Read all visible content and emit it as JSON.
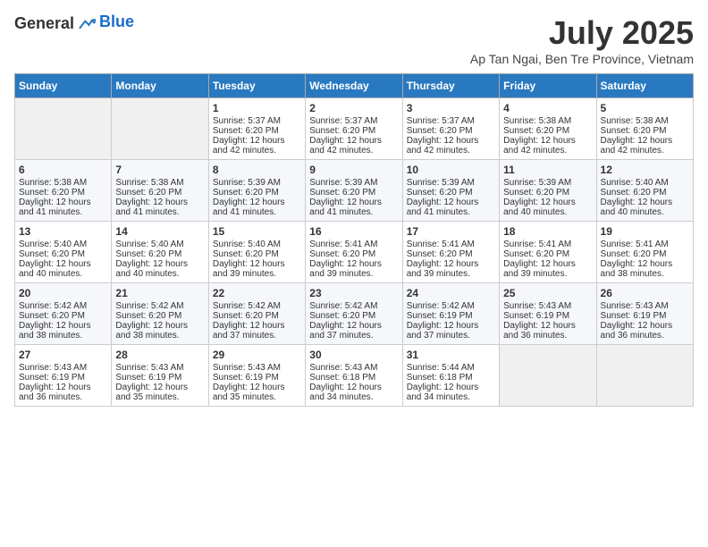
{
  "header": {
    "logo_general": "General",
    "logo_blue": "Blue",
    "month_year": "July 2025",
    "location": "Ap Tan Ngai, Ben Tre Province, Vietnam"
  },
  "days_of_week": [
    "Sunday",
    "Monday",
    "Tuesday",
    "Wednesday",
    "Thursday",
    "Friday",
    "Saturday"
  ],
  "weeks": [
    [
      {
        "day": "",
        "empty": true
      },
      {
        "day": "",
        "empty": true
      },
      {
        "day": "1",
        "sunrise": "Sunrise: 5:37 AM",
        "sunset": "Sunset: 6:20 PM",
        "daylight": "Daylight: 12 hours and 42 minutes."
      },
      {
        "day": "2",
        "sunrise": "Sunrise: 5:37 AM",
        "sunset": "Sunset: 6:20 PM",
        "daylight": "Daylight: 12 hours and 42 minutes."
      },
      {
        "day": "3",
        "sunrise": "Sunrise: 5:37 AM",
        "sunset": "Sunset: 6:20 PM",
        "daylight": "Daylight: 12 hours and 42 minutes."
      },
      {
        "day": "4",
        "sunrise": "Sunrise: 5:38 AM",
        "sunset": "Sunset: 6:20 PM",
        "daylight": "Daylight: 12 hours and 42 minutes."
      },
      {
        "day": "5",
        "sunrise": "Sunrise: 5:38 AM",
        "sunset": "Sunset: 6:20 PM",
        "daylight": "Daylight: 12 hours and 42 minutes."
      }
    ],
    [
      {
        "day": "6",
        "sunrise": "Sunrise: 5:38 AM",
        "sunset": "Sunset: 6:20 PM",
        "daylight": "Daylight: 12 hours and 41 minutes."
      },
      {
        "day": "7",
        "sunrise": "Sunrise: 5:38 AM",
        "sunset": "Sunset: 6:20 PM",
        "daylight": "Daylight: 12 hours and 41 minutes."
      },
      {
        "day": "8",
        "sunrise": "Sunrise: 5:39 AM",
        "sunset": "Sunset: 6:20 PM",
        "daylight": "Daylight: 12 hours and 41 minutes."
      },
      {
        "day": "9",
        "sunrise": "Sunrise: 5:39 AM",
        "sunset": "Sunset: 6:20 PM",
        "daylight": "Daylight: 12 hours and 41 minutes."
      },
      {
        "day": "10",
        "sunrise": "Sunrise: 5:39 AM",
        "sunset": "Sunset: 6:20 PM",
        "daylight": "Daylight: 12 hours and 41 minutes."
      },
      {
        "day": "11",
        "sunrise": "Sunrise: 5:39 AM",
        "sunset": "Sunset: 6:20 PM",
        "daylight": "Daylight: 12 hours and 40 minutes."
      },
      {
        "day": "12",
        "sunrise": "Sunrise: 5:40 AM",
        "sunset": "Sunset: 6:20 PM",
        "daylight": "Daylight: 12 hours and 40 minutes."
      }
    ],
    [
      {
        "day": "13",
        "sunrise": "Sunrise: 5:40 AM",
        "sunset": "Sunset: 6:20 PM",
        "daylight": "Daylight: 12 hours and 40 minutes."
      },
      {
        "day": "14",
        "sunrise": "Sunrise: 5:40 AM",
        "sunset": "Sunset: 6:20 PM",
        "daylight": "Daylight: 12 hours and 40 minutes."
      },
      {
        "day": "15",
        "sunrise": "Sunrise: 5:40 AM",
        "sunset": "Sunset: 6:20 PM",
        "daylight": "Daylight: 12 hours and 39 minutes."
      },
      {
        "day": "16",
        "sunrise": "Sunrise: 5:41 AM",
        "sunset": "Sunset: 6:20 PM",
        "daylight": "Daylight: 12 hours and 39 minutes."
      },
      {
        "day": "17",
        "sunrise": "Sunrise: 5:41 AM",
        "sunset": "Sunset: 6:20 PM",
        "daylight": "Daylight: 12 hours and 39 minutes."
      },
      {
        "day": "18",
        "sunrise": "Sunrise: 5:41 AM",
        "sunset": "Sunset: 6:20 PM",
        "daylight": "Daylight: 12 hours and 39 minutes."
      },
      {
        "day": "19",
        "sunrise": "Sunrise: 5:41 AM",
        "sunset": "Sunset: 6:20 PM",
        "daylight": "Daylight: 12 hours and 38 minutes."
      }
    ],
    [
      {
        "day": "20",
        "sunrise": "Sunrise: 5:42 AM",
        "sunset": "Sunset: 6:20 PM",
        "daylight": "Daylight: 12 hours and 38 minutes."
      },
      {
        "day": "21",
        "sunrise": "Sunrise: 5:42 AM",
        "sunset": "Sunset: 6:20 PM",
        "daylight": "Daylight: 12 hours and 38 minutes."
      },
      {
        "day": "22",
        "sunrise": "Sunrise: 5:42 AM",
        "sunset": "Sunset: 6:20 PM",
        "daylight": "Daylight: 12 hours and 37 minutes."
      },
      {
        "day": "23",
        "sunrise": "Sunrise: 5:42 AM",
        "sunset": "Sunset: 6:20 PM",
        "daylight": "Daylight: 12 hours and 37 minutes."
      },
      {
        "day": "24",
        "sunrise": "Sunrise: 5:42 AM",
        "sunset": "Sunset: 6:19 PM",
        "daylight": "Daylight: 12 hours and 37 minutes."
      },
      {
        "day": "25",
        "sunrise": "Sunrise: 5:43 AM",
        "sunset": "Sunset: 6:19 PM",
        "daylight": "Daylight: 12 hours and 36 minutes."
      },
      {
        "day": "26",
        "sunrise": "Sunrise: 5:43 AM",
        "sunset": "Sunset: 6:19 PM",
        "daylight": "Daylight: 12 hours and 36 minutes."
      }
    ],
    [
      {
        "day": "27",
        "sunrise": "Sunrise: 5:43 AM",
        "sunset": "Sunset: 6:19 PM",
        "daylight": "Daylight: 12 hours and 36 minutes."
      },
      {
        "day": "28",
        "sunrise": "Sunrise: 5:43 AM",
        "sunset": "Sunset: 6:19 PM",
        "daylight": "Daylight: 12 hours and 35 minutes."
      },
      {
        "day": "29",
        "sunrise": "Sunrise: 5:43 AM",
        "sunset": "Sunset: 6:19 PM",
        "daylight": "Daylight: 12 hours and 35 minutes."
      },
      {
        "day": "30",
        "sunrise": "Sunrise: 5:43 AM",
        "sunset": "Sunset: 6:18 PM",
        "daylight": "Daylight: 12 hours and 34 minutes."
      },
      {
        "day": "31",
        "sunrise": "Sunrise: 5:44 AM",
        "sunset": "Sunset: 6:18 PM",
        "daylight": "Daylight: 12 hours and 34 minutes."
      },
      {
        "day": "",
        "empty": true
      },
      {
        "day": "",
        "empty": true
      }
    ]
  ]
}
